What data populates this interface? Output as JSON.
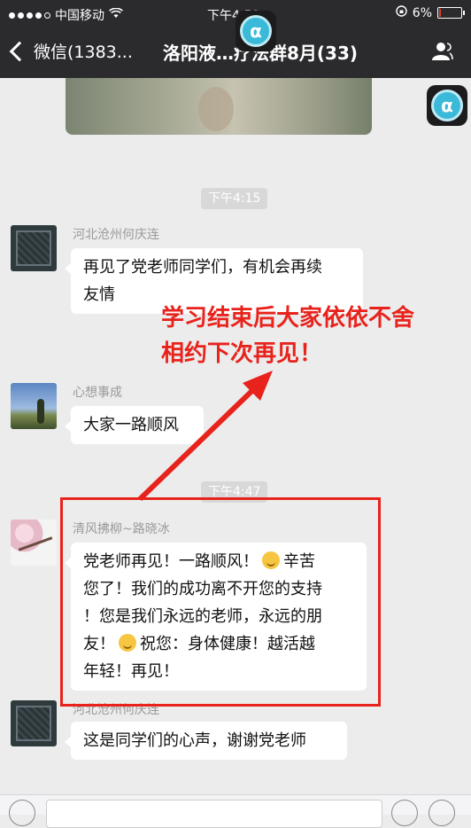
{
  "status_bar": {
    "carrier": "中国移动",
    "time": "下午4:50",
    "battery": "6%",
    "battery_level": 0.06
  },
  "nav": {
    "back_label": "微信(1383...",
    "title": "洛阳液…疗法群8月(33)",
    "contact_icon": "group-members-icon"
  },
  "badge_symbol": "α",
  "messages": [
    {
      "time": "下午4:15"
    },
    {
      "sender": "河北沧州何庆连",
      "text_lines": [
        "再见了党老师同学们，有机会再续",
        "友情"
      ]
    },
    {
      "sender": "心想事成",
      "text": "大家一路顺风"
    },
    {
      "time": "下午4:47"
    },
    {
      "sender": "清风拂柳~路晓冰",
      "line1_a": "党老师再见！一路顺风！",
      "line1_b": "辛苦",
      "line2": "您了！我们的成功离不开您的支持",
      "line3": "！您是我们永远的老师，永远的朋",
      "line4_a": "友！",
      "line4_b": "祝您：身体健康！越活越",
      "line5": "年轻！再见！"
    },
    {
      "sender": "河北沧州何庆连",
      "text": "这是同学们的心声，谢谢党老师"
    }
  ],
  "annotation": {
    "line1": "学习结束后大家依依不舍",
    "line2": "相约下次再见！",
    "color": "#e8231c"
  }
}
